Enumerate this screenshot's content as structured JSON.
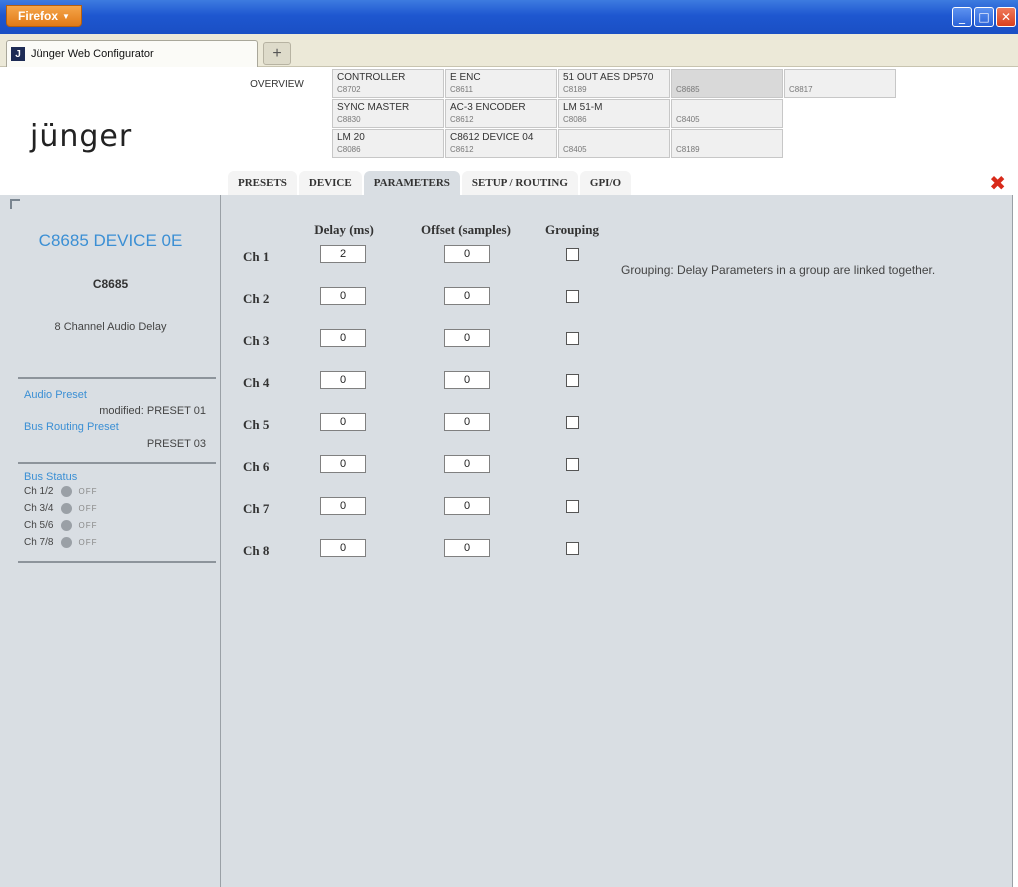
{
  "browser": {
    "menu_button": "Firefox",
    "tab_title": "Jünger Web Configurator",
    "favicon_letter": "J",
    "new_tab": "+",
    "controls": {
      "minimize": "_",
      "maximize": "□",
      "close": "✕"
    }
  },
  "header": {
    "logo": "jünger",
    "overview_label": "OVERVIEW",
    "devices": [
      {
        "name": "CONTROLLER",
        "code": "C8702"
      },
      {
        "name": "E ENC",
        "code": "C8611"
      },
      {
        "name": "51 OUT AES DP570",
        "code": "C8189"
      },
      {
        "name": "",
        "code": "C8685"
      },
      {
        "name": "",
        "code": "C8817"
      },
      {
        "name": "SYNC MASTER",
        "code": "C8830"
      },
      {
        "name": "AC-3 ENCODER",
        "code": "C8612"
      },
      {
        "name": "LM 51-M",
        "code": "C8086"
      },
      {
        "name": "",
        "code": "C8405"
      },
      {
        "name": "LM 20",
        "code": "C8086"
      },
      {
        "name": "C8612 DEVICE 04",
        "code": "C8612"
      },
      {
        "name": "",
        "code": "C8405"
      },
      {
        "name": "",
        "code": "C8189"
      }
    ],
    "close_icon": "✖"
  },
  "tabs": [
    "PRESETS",
    "DEVICE",
    "PARAMETERS",
    "SETUP / ROUTING",
    "GPI/O"
  ],
  "active_tab": "PARAMETERS",
  "sidebar": {
    "device_title": "C8685 DEVICE 0E",
    "model": "C8685",
    "description": "8 Channel Audio Delay",
    "audio_preset_label": "Audio Preset",
    "audio_preset_value": "modified: PRESET 01",
    "bus_routing_label": "Bus Routing Preset",
    "bus_routing_value": "PRESET 03",
    "bus_status_label": "Bus Status",
    "bus_status": [
      {
        "label": "Ch 1/2",
        "state": "OFF"
      },
      {
        "label": "Ch 3/4",
        "state": "OFF"
      },
      {
        "label": "Ch 5/6",
        "state": "OFF"
      },
      {
        "label": "Ch 7/8",
        "state": "OFF"
      }
    ]
  },
  "params": {
    "col_delay": "Delay (ms)",
    "col_offset": "Offset (samples)",
    "col_grouping": "Grouping",
    "hint": "Grouping: Delay Parameters in a group are linked together.",
    "channels": [
      {
        "label": "Ch 1",
        "delay": "2",
        "offset": "0",
        "grouped": false
      },
      {
        "label": "Ch 2",
        "delay": "0",
        "offset": "0",
        "grouped": false
      },
      {
        "label": "Ch 3",
        "delay": "0",
        "offset": "0",
        "grouped": false
      },
      {
        "label": "Ch 4",
        "delay": "0",
        "offset": "0",
        "grouped": false
      },
      {
        "label": "Ch 5",
        "delay": "0",
        "offset": "0",
        "grouped": false
      },
      {
        "label": "Ch 6",
        "delay": "0",
        "offset": "0",
        "grouped": false
      },
      {
        "label": "Ch 7",
        "delay": "0",
        "offset": "0",
        "grouped": false
      },
      {
        "label": "Ch 8",
        "delay": "0",
        "offset": "0",
        "grouped": false
      }
    ]
  }
}
